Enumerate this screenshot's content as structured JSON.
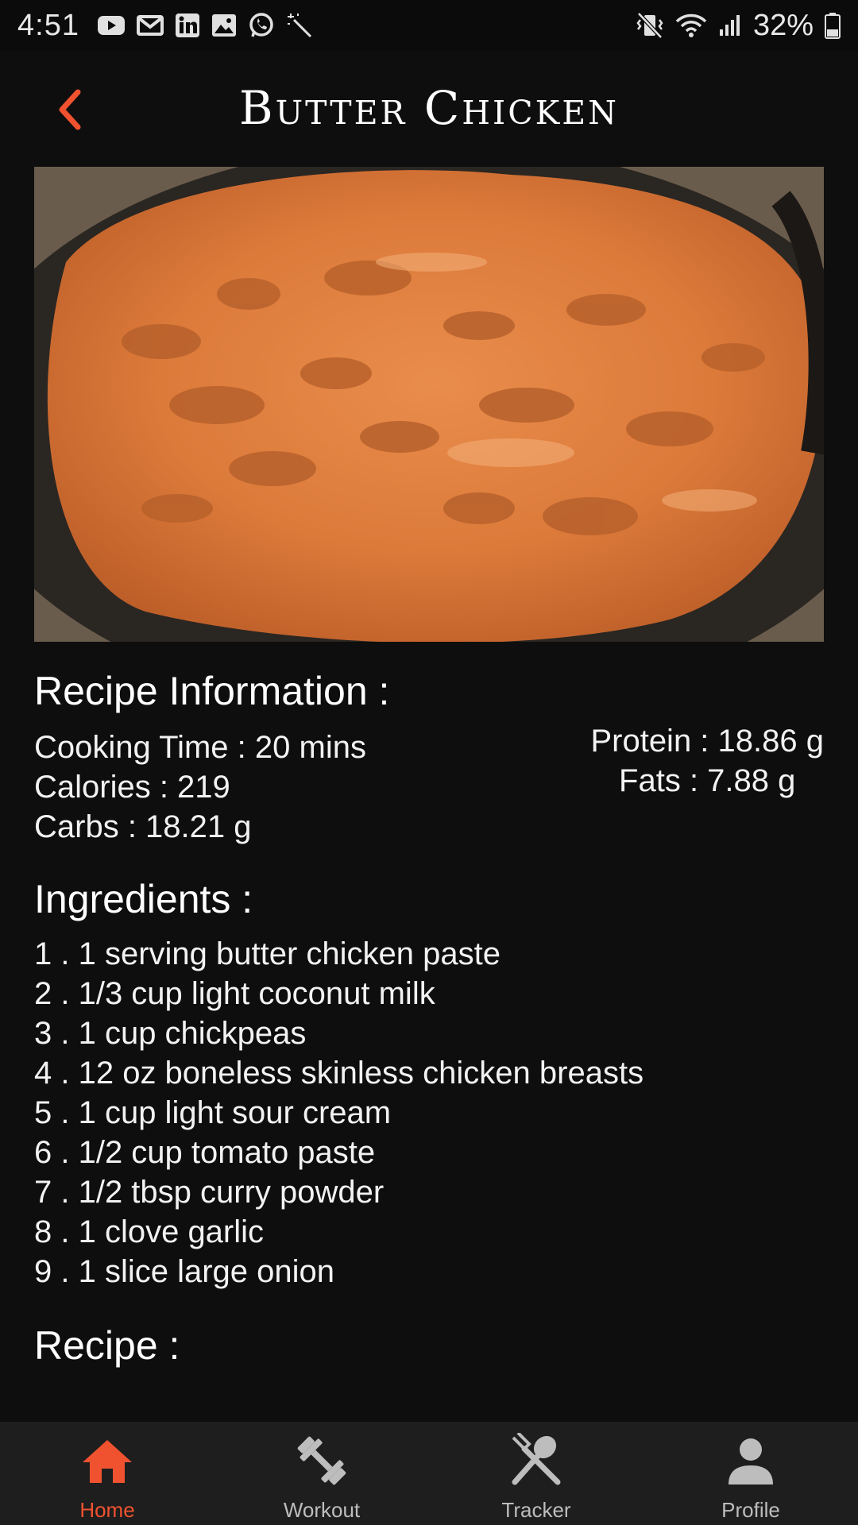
{
  "status_bar": {
    "time": "4:51",
    "battery": "32%",
    "left_icons": [
      "youtube-icon",
      "gmail-icon",
      "linkedin-icon",
      "gallery-icon",
      "whatsapp-icon",
      "magic-wand-icon"
    ],
    "right_icons": [
      "vibrate-icon",
      "wifi-icon",
      "signal-icon",
      "battery-icon"
    ]
  },
  "header": {
    "title": "Butter Chicken",
    "back_icon": "chevron-left-icon",
    "accent": "#f0522f"
  },
  "recipe_info": {
    "heading": "Recipe Information :",
    "cooking_time": "Cooking Time : 20 mins",
    "calories": "Calories : 219",
    "carbs": "Carbs : 18.21 g",
    "protein": "Protein : 18.86 g",
    "fats": "Fats : 7.88 g"
  },
  "ingredients": {
    "heading": "Ingredients :",
    "items": [
      "1 . 1 serving butter chicken paste",
      "2 . 1/3 cup light coconut milk",
      "3 . 1 cup chickpeas",
      "4 . 12 oz boneless skinless chicken breasts",
      "5 . 1 cup light sour cream",
      "6 . 1/2 cup tomato paste",
      "7 . 1/2 tbsp curry powder",
      "8 . 1 clove garlic",
      "9 . 1 slice large onion"
    ]
  },
  "recipe": {
    "heading": "Recipe :"
  },
  "bottom_nav": {
    "items": [
      {
        "label": "Home",
        "icon": "home-icon",
        "active": true
      },
      {
        "label": "Workout",
        "icon": "dumbbell-icon",
        "active": false
      },
      {
        "label": "Tracker",
        "icon": "utensils-icon",
        "active": false
      },
      {
        "label": "Profile",
        "icon": "person-icon",
        "active": false
      }
    ],
    "active_color": "#f0522f",
    "inactive_color": "#bdbdbd"
  }
}
